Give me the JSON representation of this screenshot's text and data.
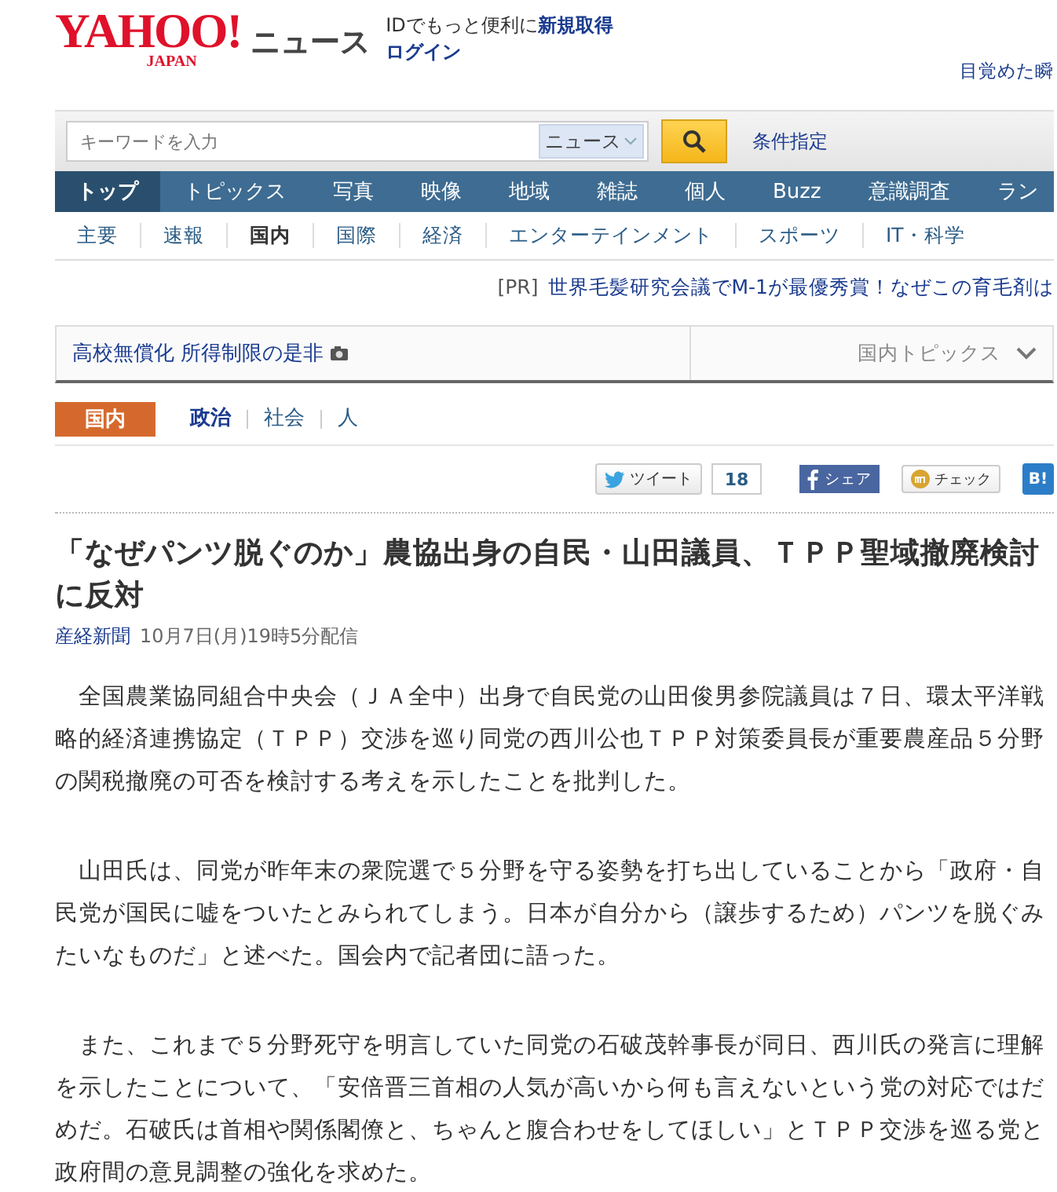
{
  "header": {
    "logo": "YAHOO!",
    "logo_sub": "JAPAN",
    "service": "ニュース",
    "id_prompt": "IDでもっと便利に",
    "register_link": "新規取得",
    "login_link": "ログイン",
    "promo_link": "目覚めた瞬"
  },
  "search": {
    "placeholder": "キーワードを入力",
    "scope": "ニュース",
    "condition_link": "条件指定"
  },
  "main_nav": [
    {
      "label": "トップ",
      "selected": true
    },
    {
      "label": "トピックス",
      "selected": false
    },
    {
      "label": "写真",
      "selected": false
    },
    {
      "label": "映像",
      "selected": false
    },
    {
      "label": "地域",
      "selected": false
    },
    {
      "label": "雑誌",
      "selected": false
    },
    {
      "label": "個人",
      "selected": false
    },
    {
      "label": "Buzz",
      "selected": false
    },
    {
      "label": "意識調査",
      "selected": false
    },
    {
      "label": "ラン",
      "selected": false
    }
  ],
  "sub_nav": [
    {
      "label": "主要",
      "selected": false
    },
    {
      "label": "速報",
      "selected": false
    },
    {
      "label": "国内",
      "selected": true
    },
    {
      "label": "国際",
      "selected": false
    },
    {
      "label": "経済",
      "selected": false
    },
    {
      "label": "エンターテインメント",
      "selected": false
    },
    {
      "label": "スポーツ",
      "selected": false
    },
    {
      "label": "IT・科学",
      "selected": false
    }
  ],
  "ad": {
    "tag": "[PR]",
    "text": "世界毛髪研究会議でM-1が最優秀賞！なぜこの育毛剤は"
  },
  "topic_bar": {
    "topic": "高校無償化 所得制限の是非",
    "dropdown": "国内トピックス"
  },
  "category": {
    "label": "国内",
    "items": [
      {
        "label": "政治",
        "selected": true
      },
      {
        "label": "社会",
        "selected": false
      },
      {
        "label": "人",
        "selected": false
      }
    ]
  },
  "social": {
    "tweet": "ツイート",
    "tweet_count": "18",
    "share": "シェア",
    "check": "チェック",
    "hatena": "B!"
  },
  "article": {
    "title": "「なぜパンツ脱ぐのか」農協出身の自民・山田議員、ＴＰＰ聖域撤廃検討に反対",
    "source": "産経新聞",
    "date": "10月7日(月)19時5分配信",
    "paragraphs": [
      "　全国農業協同組合中央会（ＪＡ全中）出身で自民党の山田俊男参院議員は７日、環太平洋戦略的経済連携協定（ＴＰＰ）交渉を巡り同党の西川公也ＴＰＰ対策委員長が重要農産品５分野の関税撤廃の可否を検討する考えを示したことを批判した。",
      "　山田氏は、同党が昨年末の衆院選で５分野を守る姿勢を打ち出していることから「政府・自民党が国民に嘘をついたとみられてしまう。日本が自分から（譲歩するため）パンツを脱ぐみたいなものだ」と述べた。国会内で記者団に語った。",
      "　また、これまで５分野死守を明言していた同党の石破茂幹事長が同日、西川氏の発言に理解を示したことについて、「安倍晋三首相の人気が高いから何も言えないという党の対応ではだめだ。石破氏は首相や関係閣僚と、ちゃんと腹合わせをしてほしい」とＴＰＰ交渉を巡る党と政府間の意見調整の強化を求めた。"
    ]
  }
}
